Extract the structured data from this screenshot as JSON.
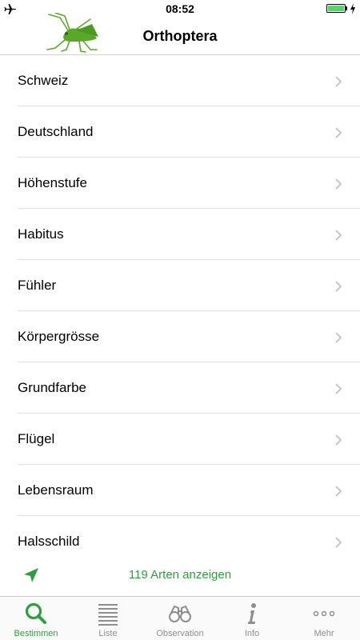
{
  "status_bar": {
    "time": "08:52",
    "battery_level": 1.0,
    "icons": [
      "airplane-icon",
      "battery-icon",
      "charging-icon"
    ]
  },
  "nav": {
    "title": "Orthoptera",
    "logo": "grasshopper-logo"
  },
  "filters": [
    {
      "label": "Schweiz"
    },
    {
      "label": "Deutschland"
    },
    {
      "label": "Höhenstufe"
    },
    {
      "label": "Habitus"
    },
    {
      "label": "Fühler"
    },
    {
      "label": "Körpergrösse"
    },
    {
      "label": "Grundfarbe"
    },
    {
      "label": "Flügel"
    },
    {
      "label": "Lebensraum"
    },
    {
      "label": "Halsschild"
    }
  ],
  "show_results": {
    "label": "119 Arten anzeigen",
    "icon": "location-arrow-icon"
  },
  "tabs": [
    {
      "label": "Bestimmen",
      "icon": "search-icon",
      "active": true
    },
    {
      "label": "Liste",
      "icon": "list-icon",
      "active": false
    },
    {
      "label": "Observation",
      "icon": "binoculars-icon",
      "active": false
    },
    {
      "label": "Info",
      "icon": "info-icon",
      "active": false
    },
    {
      "label": "Mehr",
      "icon": "more-icon",
      "active": false
    }
  ],
  "colors": {
    "accent": "#2e9e3e",
    "inactive": "#8e8e8e",
    "battery": "#4cd964"
  }
}
